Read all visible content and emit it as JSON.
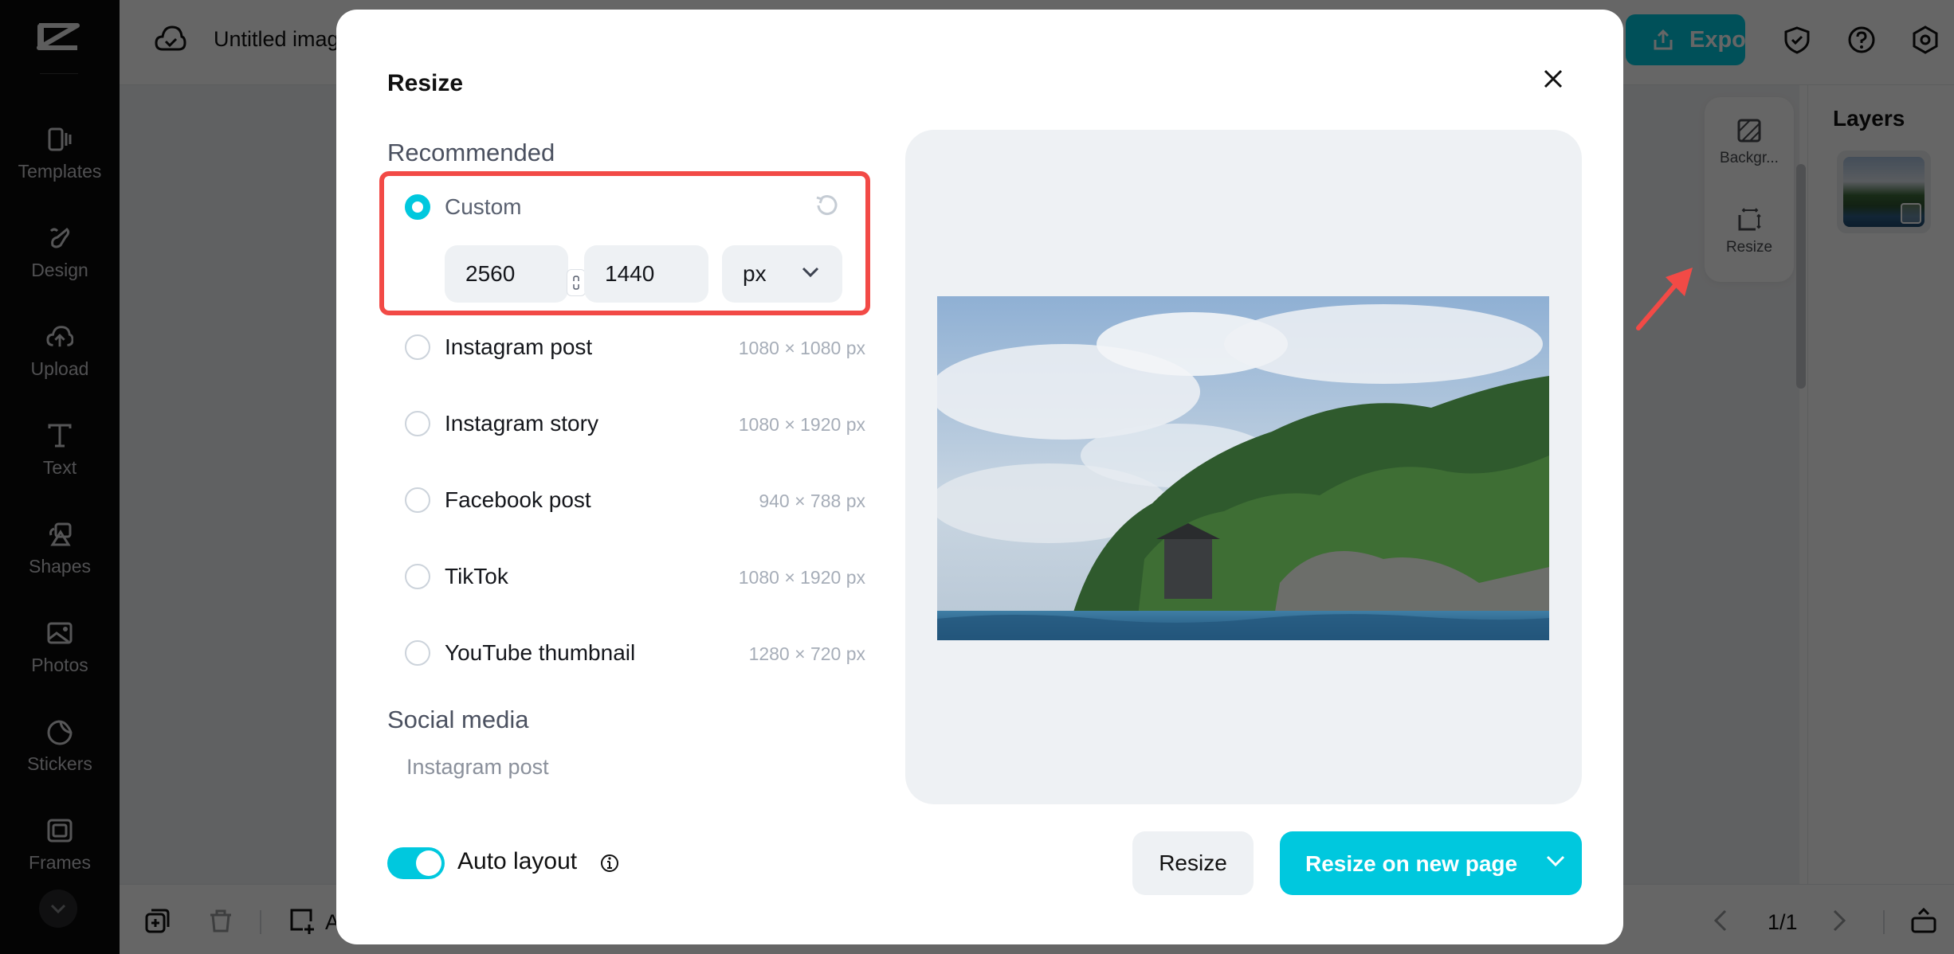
{
  "app": {
    "document_title": "Untitled image",
    "sidebar": {
      "items": [
        {
          "label": "Templates",
          "icon": "templates-icon"
        },
        {
          "label": "Design",
          "icon": "design-icon"
        },
        {
          "label": "Upload",
          "icon": "upload-icon"
        },
        {
          "label": "Text",
          "icon": "text-icon"
        },
        {
          "label": "Shapes",
          "icon": "shapes-icon"
        },
        {
          "label": "Photos",
          "icon": "photos-icon"
        },
        {
          "label": "Stickers",
          "icon": "stickers-icon"
        },
        {
          "label": "Frames",
          "icon": "frames-icon"
        }
      ]
    },
    "topbar": {
      "export_label": "Export"
    },
    "float_panel": {
      "background_label": "Backgr...",
      "resize_label": "Resize"
    },
    "layers": {
      "title": "Layers"
    },
    "bottombar": {
      "add_label": "A",
      "page_indicator": "1/1"
    }
  },
  "modal": {
    "title": "Resize",
    "recommended_label": "Recommended",
    "custom": {
      "label": "Custom",
      "selected": true,
      "width": "2560",
      "height": "1440",
      "unit": "px"
    },
    "presets": [
      {
        "label": "Instagram post",
        "size": "1080 × 1080 px"
      },
      {
        "label": "Instagram story",
        "size": "1080 × 1920 px"
      },
      {
        "label": "Facebook post",
        "size": "940 × 788 px"
      },
      {
        "label": "TikTok",
        "size": "1080 × 1920 px"
      },
      {
        "label": "YouTube thumbnail",
        "size": "1280 × 720 px"
      }
    ],
    "social_media_label": "Social media",
    "social_media_first_item": "Instagram post",
    "auto_layout": {
      "label": "Auto layout",
      "enabled": true
    },
    "resize_button": "Resize",
    "resize_new_page_button": "Resize on new page"
  },
  "colors": {
    "accent": "#00c8de",
    "annotation": "#f24a46"
  }
}
